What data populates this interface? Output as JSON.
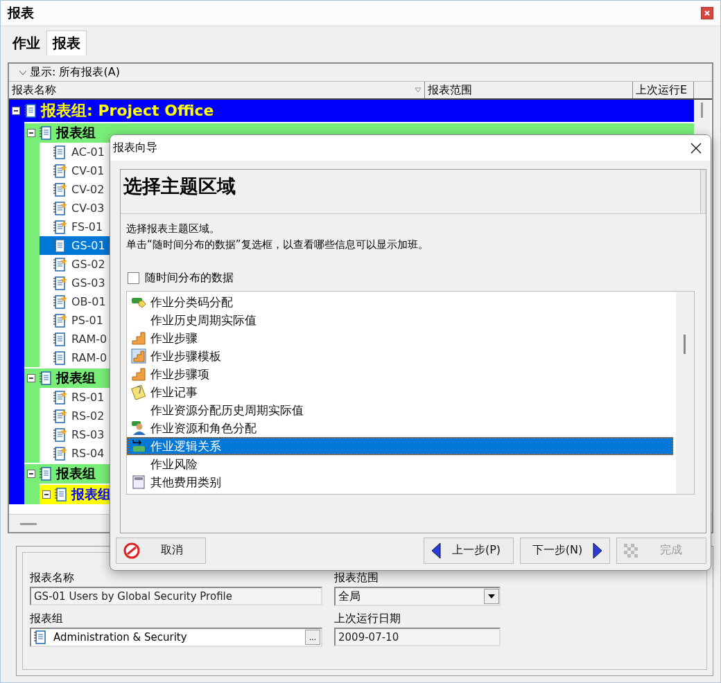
{
  "window": {
    "title": "报表"
  },
  "tabs": [
    {
      "label": "作业",
      "selected": false
    },
    {
      "label": "报表",
      "selected": true
    }
  ],
  "filter": {
    "label": "显示: 所有报表(A)"
  },
  "columns": [
    "报表名称",
    "报表范围",
    "上次运行E"
  ],
  "tree": [
    {
      "label": "报表组: Project Office",
      "expanded": true,
      "children": [
        {
          "label": "报表组",
          "expanded": true,
          "children": [
            {
              "label": "AC-01",
              "kind": "plain",
              "selected": false
            },
            {
              "label": "CV-01",
              "kind": "starred",
              "selected": false
            },
            {
              "label": "CV-02",
              "kind": "starred",
              "selected": false
            },
            {
              "label": "CV-03",
              "kind": "starred",
              "selected": false
            },
            {
              "label": "FS-01",
              "kind": "starred",
              "selected": false
            },
            {
              "label": "GS-01",
              "kind": "plain",
              "selected": true
            },
            {
              "label": "GS-02",
              "kind": "starred",
              "selected": false
            },
            {
              "label": "GS-03",
              "kind": "starred",
              "selected": false
            },
            {
              "label": "OB-01",
              "kind": "starred",
              "selected": false
            },
            {
              "label": "PS-01",
              "kind": "starred",
              "selected": false
            },
            {
              "label": "RAM-0",
              "kind": "plain",
              "selected": false
            },
            {
              "label": "RAM-0",
              "kind": "plain",
              "selected": false
            }
          ]
        },
        {
          "label": "报表组",
          "expanded": true,
          "children": [
            {
              "label": "RS-01",
              "kind": "starred",
              "selected": false
            },
            {
              "label": "RS-02",
              "kind": "starred",
              "selected": false
            },
            {
              "label": "RS-03",
              "kind": "starred",
              "selected": false
            },
            {
              "label": "RS-04",
              "kind": "starred",
              "selected": false
            }
          ]
        },
        {
          "label": "报表组",
          "expanded": true,
          "children": [
            {
              "label": "报表组",
              "expanded": true
            }
          ]
        }
      ]
    }
  ],
  "details": {
    "fields": [
      {
        "label": "报表名称",
        "value": "GS-01 Users by Global Security Profile",
        "kind": "text"
      },
      {
        "label": "报表范围",
        "value": "全局",
        "kind": "select"
      },
      {
        "label": "报表组",
        "value": "Administration & Security",
        "kind": "picker",
        "button": "..."
      },
      {
        "label": "上次运行日期",
        "value": "2009-07-10",
        "kind": "text"
      }
    ]
  },
  "dialog": {
    "title": "报表向导",
    "heading": "选择主题区域",
    "lines": [
      "选择报表主题区域。",
      "单击“随时间分布的数据”复选框，以查看哪些信息可以显示加班。"
    ],
    "checkbox": {
      "label": "随时间分布的数据",
      "checked": false
    },
    "subjects": [
      {
        "label": "作业分类码分配",
        "kind": "tag",
        "selected": false
      },
      {
        "label": "作业历史周期实际值",
        "kind": "none",
        "selected": false
      },
      {
        "label": "作业步骤",
        "kind": "steps",
        "selected": false
      },
      {
        "label": "作业步骤模板",
        "kind": "template",
        "selected": false
      },
      {
        "label": "作业步骤项",
        "kind": "steps",
        "selected": false
      },
      {
        "label": "作业记事",
        "kind": "note",
        "selected": false
      },
      {
        "label": "作业资源分配历史周期实际值",
        "kind": "none",
        "selected": false
      },
      {
        "label": "作业资源和角色分配",
        "kind": "person",
        "selected": false
      },
      {
        "label": "作业逻辑关系",
        "kind": "link",
        "selected": true
      },
      {
        "label": "作业风险",
        "kind": "none",
        "selected": false
      },
      {
        "label": "其他费用类别",
        "kind": "calc",
        "selected": false
      }
    ],
    "buttons": [
      {
        "label": "取消",
        "kind": "cancel",
        "disabled": false
      },
      {
        "label": "上一步(P)",
        "kind": "back",
        "disabled": false
      },
      {
        "label": "下一步(N)",
        "kind": "next",
        "disabled": false
      },
      {
        "label": "完成",
        "kind": "finish",
        "disabled": true
      }
    ]
  }
}
